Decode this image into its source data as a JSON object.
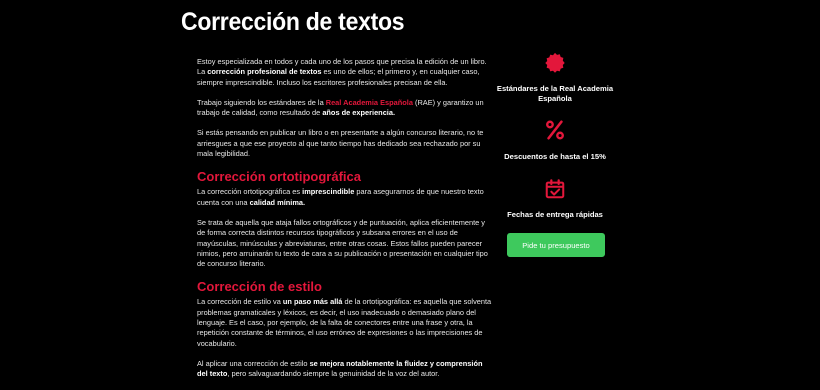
{
  "page": {
    "title": "Corrección de textos"
  },
  "intro": {
    "p1_a": "Estoy especializada en todos y cada uno de los pasos que precisa la edición de un libro. La ",
    "p1_b": "corrección profesional de textos",
    "p1_c": " es uno de ellos; el primero y, en cualquier caso, siempre imprescindible. Incluso los escritores profesionales precisan de ella.",
    "p2_a": "Trabajo siguiendo los estándares de la ",
    "p2_b": "Real Academia Española",
    "p2_c": " (RAE) y garantizo un trabajo de calidad, como resultado de ",
    "p2_d": "años de experiencia.",
    "p3": "Si estás pensando en publicar un libro o en presentarte a algún concurso literario, no te arriesgues a que ese proyecto al que tanto tiempo has dedicado sea rechazado por su mala legibilidad."
  },
  "ortho": {
    "heading": "Corrección ortotipográfica",
    "p1_a": "La corrección ortotipográfica es ",
    "p1_b": "imprescindible",
    "p1_c": " para asegurarnos de que nuestro texto cuenta con una ",
    "p1_d": "calidad mínima.",
    "p2": "Se trata de aquella que ataja fallos ortográficos y de puntuación, aplica eficientemente y de forma correcta distintos recursos tipográficos y subsana errores en el uso de mayúsculas, minúsculas y abreviaturas, entre otras cosas. Estos fallos pueden parecer nimios, pero arruinarán tu texto de cara a su publicación o presentación en cualquier tipo de concurso literario."
  },
  "style": {
    "heading": "Corrección de estilo",
    "p1_a": "La corrección de estilo va ",
    "p1_b": "un paso más allá",
    "p1_c": " de la ortotipográfica: es aquella que solventa problemas gramaticales y léxicos, es decir, el uso inadecuado o demasiado plano del lenguaje. Es el caso, por ejemplo, de la falta de conectores entre una frase y otra, la repetición constante de términos, el uso erróneo de expresiones o las imprecisiones de vocabulario.",
    "p2_a": "Al aplicar una corrección de estilo ",
    "p2_b": "se mejora notablemente la fluidez y comprensión del texto",
    "p2_c": ", pero salvaguardando siempre la genuinidad de la voz del autor."
  },
  "features": [
    {
      "icon": "badge-icon",
      "label": "Estándares de la Real Academia Española"
    },
    {
      "icon": "percent-icon",
      "label": "Descuentos de hasta el 15%"
    },
    {
      "icon": "calendar-check-icon",
      "label": "Fechas de entrega rápidas"
    }
  ],
  "cta": {
    "label": "Pide tu presupuesto"
  },
  "colors": {
    "accent": "#e3173b",
    "button": "#3ec95d",
    "background": "#000000"
  }
}
